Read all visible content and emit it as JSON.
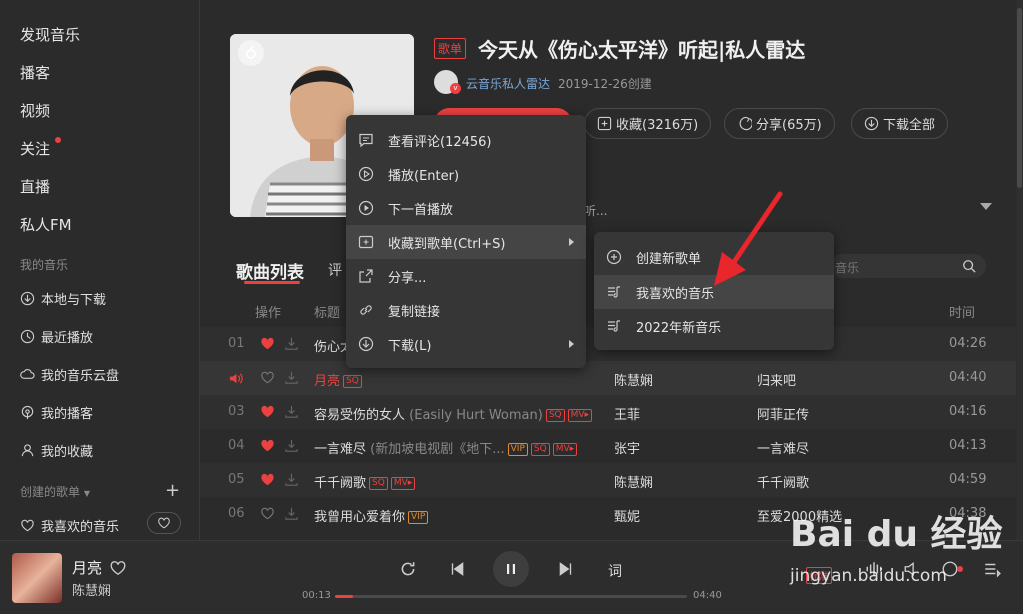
{
  "sidebar": {
    "nav": [
      "发现音乐",
      "播客",
      "视频",
      "关注",
      "直播",
      "私人FM"
    ],
    "my_music_title": "我的音乐",
    "my_music": [
      "本地与下载",
      "最近播放",
      "我的音乐云盘",
      "我的播客",
      "我的收藏"
    ],
    "created_title": "创建的歌单",
    "created": [
      "我喜欢的音乐"
    ]
  },
  "playlist": {
    "tag": "歌单",
    "title": "今天从《伤心太平洋》听起|私人雷达",
    "creator": "云音乐私人雷达",
    "created_date": "2019-12-26创建",
    "collect_label": "收藏(3216万)",
    "share_label": "分享(65万)",
    "download_all_label": "下载全部",
    "desc_tail": "聆听..."
  },
  "tabs": {
    "songs": "歌曲列表",
    "comments": "评"
  },
  "search": {
    "placeholder": "音乐"
  },
  "columns": {
    "ops": "操作",
    "title": "标题",
    "time": "时间"
  },
  "rows": [
    {
      "idx": "01",
      "title": "伤心太",
      "artist": "",
      "album": "",
      "time": "04:26",
      "liked": true,
      "badges": []
    },
    {
      "idx": "",
      "title": "月亮",
      "artist": "陈慧娴",
      "album": "归来吧",
      "time": "04:40",
      "liked": false,
      "playing": true,
      "badges": [
        "SQ"
      ]
    },
    {
      "idx": "03",
      "title": "容易受伤的女人",
      "sub": "(Easily Hurt Woman)",
      "artist": "王菲",
      "album": "阿菲正传",
      "time": "04:16",
      "liked": true,
      "badges": [
        "SQ",
        "MV▸"
      ]
    },
    {
      "idx": "04",
      "title": "一言难尽",
      "sub": "(新加坡电视剧《地下...",
      "artist": "张宇",
      "album": "一言难尽",
      "time": "04:13",
      "liked": true,
      "badges": [
        "VIP",
        "SQ",
        "MV▸"
      ]
    },
    {
      "idx": "05",
      "title": "千千阙歌",
      "artist": "陈慧娴",
      "album": "千千阙歌",
      "time": "04:59",
      "liked": true,
      "badges": [
        "SQ",
        "MV▸"
      ]
    },
    {
      "idx": "06",
      "title": "我曾用心爱着你",
      "artist": "甄妮",
      "album": "至爱2000精选",
      "time": "04:38",
      "liked": false,
      "badges": [
        "VIP"
      ]
    }
  ],
  "context_menu": [
    "查看评论(12456)",
    "播放(Enter)",
    "下一首播放",
    "收藏到歌单(Ctrl+S)",
    "分享...",
    "复制链接",
    "下载(L)"
  ],
  "submenu": [
    "创建新歌单",
    "我喜欢的音乐",
    "2022年新音乐"
  ],
  "player": {
    "song": "月亮",
    "artist": "陈慧娴",
    "current": "00:13",
    "total": "04:40",
    "progress": 0.05,
    "lyric_label": "词",
    "quality": "标准"
  },
  "watermark": {
    "brand": "Bai du 经验",
    "url": "jingyan.baidu.com"
  },
  "colors": {
    "accent": "#ec4141",
    "bg": "#2b2b2b",
    "vip": "#e08a2f"
  }
}
